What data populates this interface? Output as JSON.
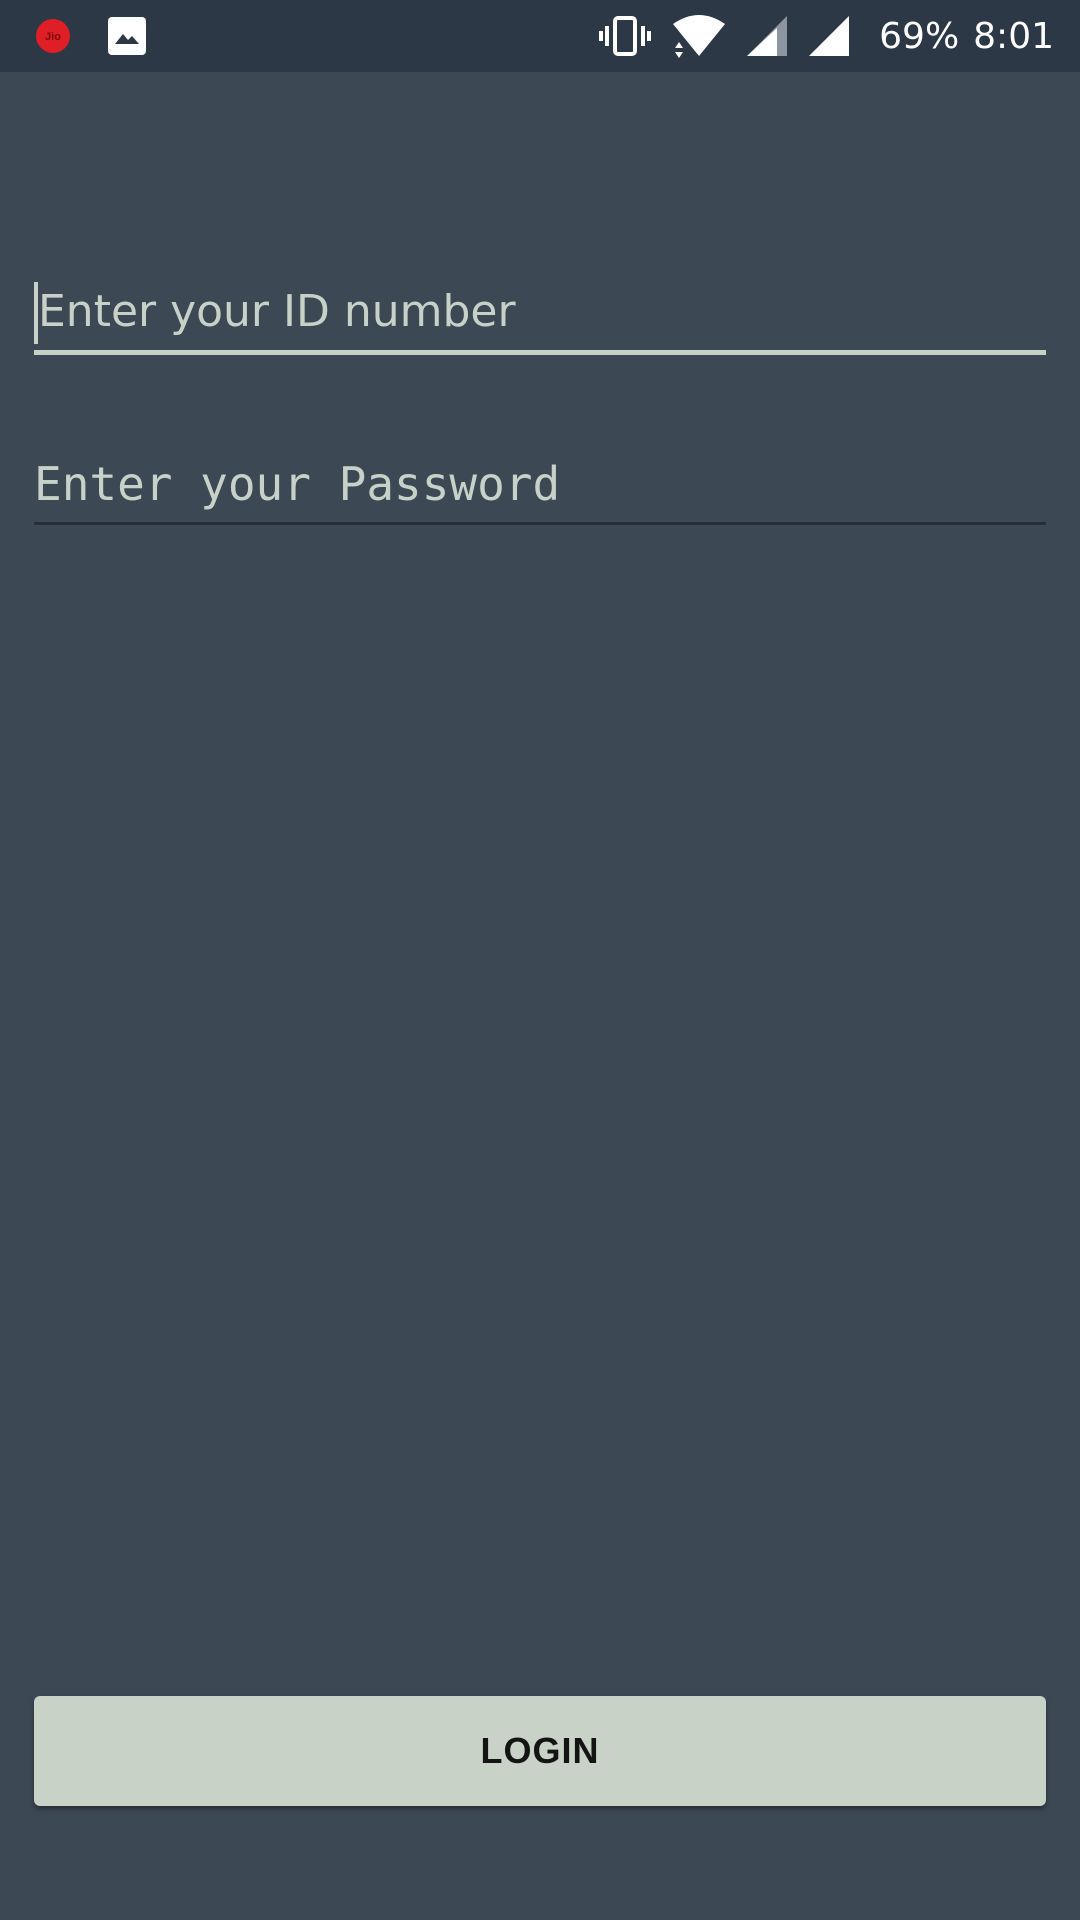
{
  "status_bar": {
    "left_icons": [
      "jio-icon",
      "image-icon"
    ],
    "right_icons": [
      "vibrate-icon",
      "wifi-icon",
      "signal-icon-1",
      "signal-icon-2"
    ],
    "battery": "69%",
    "time": "8:01",
    "jio_text": "Jio"
  },
  "form": {
    "id_placeholder": "Enter your ID number",
    "password_placeholder": "Enter your Password",
    "login_label": "LOGIN"
  },
  "colors": {
    "background": "#3d4855",
    "status_bar": "#2c3846",
    "field_text": "#c8d1c7",
    "button": "#c8d2c7"
  }
}
